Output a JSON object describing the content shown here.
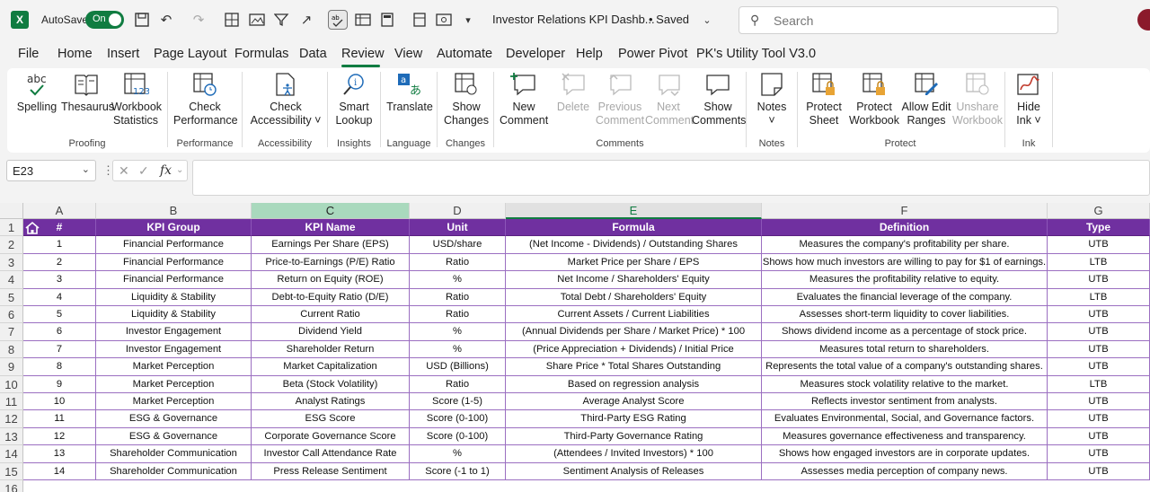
{
  "titlebar": {
    "autosave_label": "AutoSave",
    "autosave_state": "On",
    "doc_title": "Investor Relations KPI Dashb...",
    "saved_label": "• Saved",
    "search_placeholder": "Search"
  },
  "menu": {
    "tabs": [
      "File",
      "Home",
      "Insert",
      "Page Layout",
      "Formulas",
      "Data",
      "Review",
      "View",
      "Automate",
      "Developer",
      "Help",
      "Power Pivot",
      "PK's Utility Tool V3.0"
    ],
    "active": "Review"
  },
  "ribbon": {
    "groups": {
      "proofing": "Proofing",
      "performance": "Performance",
      "accessibility": "Accessibility",
      "insights": "Insights",
      "language": "Language",
      "changes": "Changes",
      "comments": "Comments",
      "notes": "Notes",
      "protect": "Protect",
      "ink": "Ink"
    },
    "buttons": {
      "spelling": "Spelling",
      "thesaurus": "Thesaurus",
      "workbook_stats_1": "Workbook",
      "workbook_stats_2": "Statistics",
      "check_perf_1": "Check",
      "check_perf_2": "Performance",
      "check_access_1": "Check",
      "check_access_2": "Accessibility ˅",
      "smart_lookup_1": "Smart",
      "smart_lookup_2": "Lookup",
      "translate": "Translate",
      "show_changes_1": "Show",
      "show_changes_2": "Changes",
      "new_comment_1": "New",
      "new_comment_2": "Comment",
      "delete": "Delete",
      "prev_comment_1": "Previous",
      "prev_comment_2": "Comment",
      "next_comment_1": "Next",
      "next_comment_2": "Comment",
      "show_comments_1": "Show",
      "show_comments_2": "Comments",
      "notes_1": "Notes",
      "notes_2": "˅",
      "protect_sheet_1": "Protect",
      "protect_sheet_2": "Sheet",
      "protect_wb_1": "Protect",
      "protect_wb_2": "Workbook",
      "allow_edit_1": "Allow Edit",
      "allow_edit_2": "Ranges",
      "unshare_1": "Unshare",
      "unshare_2": "Workbook",
      "hide_ink_1": "Hide",
      "hide_ink_2": "Ink ˅"
    }
  },
  "formula_bar": {
    "name_box": "E23",
    "formula": ""
  },
  "columns": [
    "A",
    "B",
    "C",
    "D",
    "E",
    "F",
    "G"
  ],
  "header_row": [
    "#",
    "KPI Group",
    "KPI Name",
    "Unit",
    "Formula",
    "Definition",
    "Type"
  ],
  "rows": [
    [
      "1",
      "Financial Performance",
      "Earnings Per Share (EPS)",
      "USD/share",
      "(Net Income - Dividends) / Outstanding Shares",
      "Measures the company's profitability per share.",
      "UTB"
    ],
    [
      "2",
      "Financial Performance",
      "Price-to-Earnings (P/E) Ratio",
      "Ratio",
      "Market Price per Share / EPS",
      "Shows how much investors are willing to pay for $1 of earnings.",
      "LTB"
    ],
    [
      "3",
      "Financial Performance",
      "Return on Equity (ROE)",
      "%",
      "Net Income / Shareholders' Equity",
      "Measures the profitability relative to equity.",
      "UTB"
    ],
    [
      "4",
      "Liquidity & Stability",
      "Debt-to-Equity Ratio (D/E)",
      "Ratio",
      "Total Debt / Shareholders' Equity",
      "Evaluates the financial leverage of the company.",
      "LTB"
    ],
    [
      "5",
      "Liquidity & Stability",
      "Current Ratio",
      "Ratio",
      "Current Assets / Current Liabilities",
      "Assesses short-term liquidity to cover liabilities.",
      "UTB"
    ],
    [
      "6",
      "Investor Engagement",
      "Dividend Yield",
      "%",
      "(Annual Dividends per Share / Market Price) * 100",
      "Shows dividend income as a percentage of stock price.",
      "UTB"
    ],
    [
      "7",
      "Investor Engagement",
      "Shareholder Return",
      "%",
      "(Price Appreciation + Dividends) / Initial Price",
      "Measures total return to shareholders.",
      "UTB"
    ],
    [
      "8",
      "Market Perception",
      "Market Capitalization",
      "USD (Billions)",
      "Share Price * Total Shares Outstanding",
      "Represents the total value of a company's outstanding shares.",
      "UTB"
    ],
    [
      "9",
      "Market Perception",
      "Beta (Stock Volatility)",
      "Ratio",
      "Based on regression analysis",
      "Measures stock volatility relative to the market.",
      "LTB"
    ],
    [
      "10",
      "Market Perception",
      "Analyst Ratings",
      "Score (1-5)",
      "Average Analyst Score",
      "Reflects investor sentiment from analysts.",
      "UTB"
    ],
    [
      "11",
      "ESG & Governance",
      "ESG Score",
      "Score (0-100)",
      "Third-Party ESG Rating",
      "Evaluates Environmental, Social, and Governance factors.",
      "UTB"
    ],
    [
      "12",
      "ESG & Governance",
      "Corporate Governance Score",
      "Score (0-100)",
      "Third-Party Governance Rating",
      "Measures governance effectiveness and transparency.",
      "UTB"
    ],
    [
      "13",
      "Shareholder Communication",
      "Investor Call Attendance Rate",
      "%",
      "(Attendees / Invited Investors) * 100",
      "Shows how engaged investors are in corporate updates.",
      "UTB"
    ],
    [
      "14",
      "Shareholder Communication",
      "Press Release Sentiment",
      "Score (-1 to 1)",
      "Sentiment Analysis of Releases",
      "Assesses media perception of company news.",
      "UTB"
    ]
  ],
  "row_numbers": [
    "1",
    "2",
    "3",
    "4",
    "5",
    "6",
    "7",
    "8",
    "9",
    "10",
    "11",
    "12",
    "13",
    "14",
    "15",
    "16"
  ],
  "colors": {
    "header_purple": "#7030a0",
    "excel_green": "#107c41"
  }
}
